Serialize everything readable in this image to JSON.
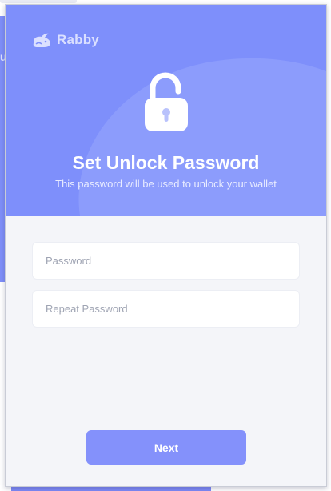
{
  "background": {
    "panel_glyph": "u"
  },
  "header": {
    "brand_name": "Rabby",
    "brand_icon": "rabbit-icon",
    "lock_icon": "unlocked-padlock-icon",
    "title": "Set Unlock Password",
    "subtitle": "This password will be used to unlock your wallet"
  },
  "form": {
    "password_placeholder": "Password",
    "password_value": "",
    "repeat_placeholder": "Repeat Password",
    "repeat_value": ""
  },
  "actions": {
    "next_label": "Next"
  },
  "colors": {
    "accent": "#7e8ffb",
    "hero_highlight": "#8c9cfc",
    "button": "#8491fb",
    "panel_background": "#f4f5f9",
    "placeholder_text": "#9fa4b3"
  }
}
